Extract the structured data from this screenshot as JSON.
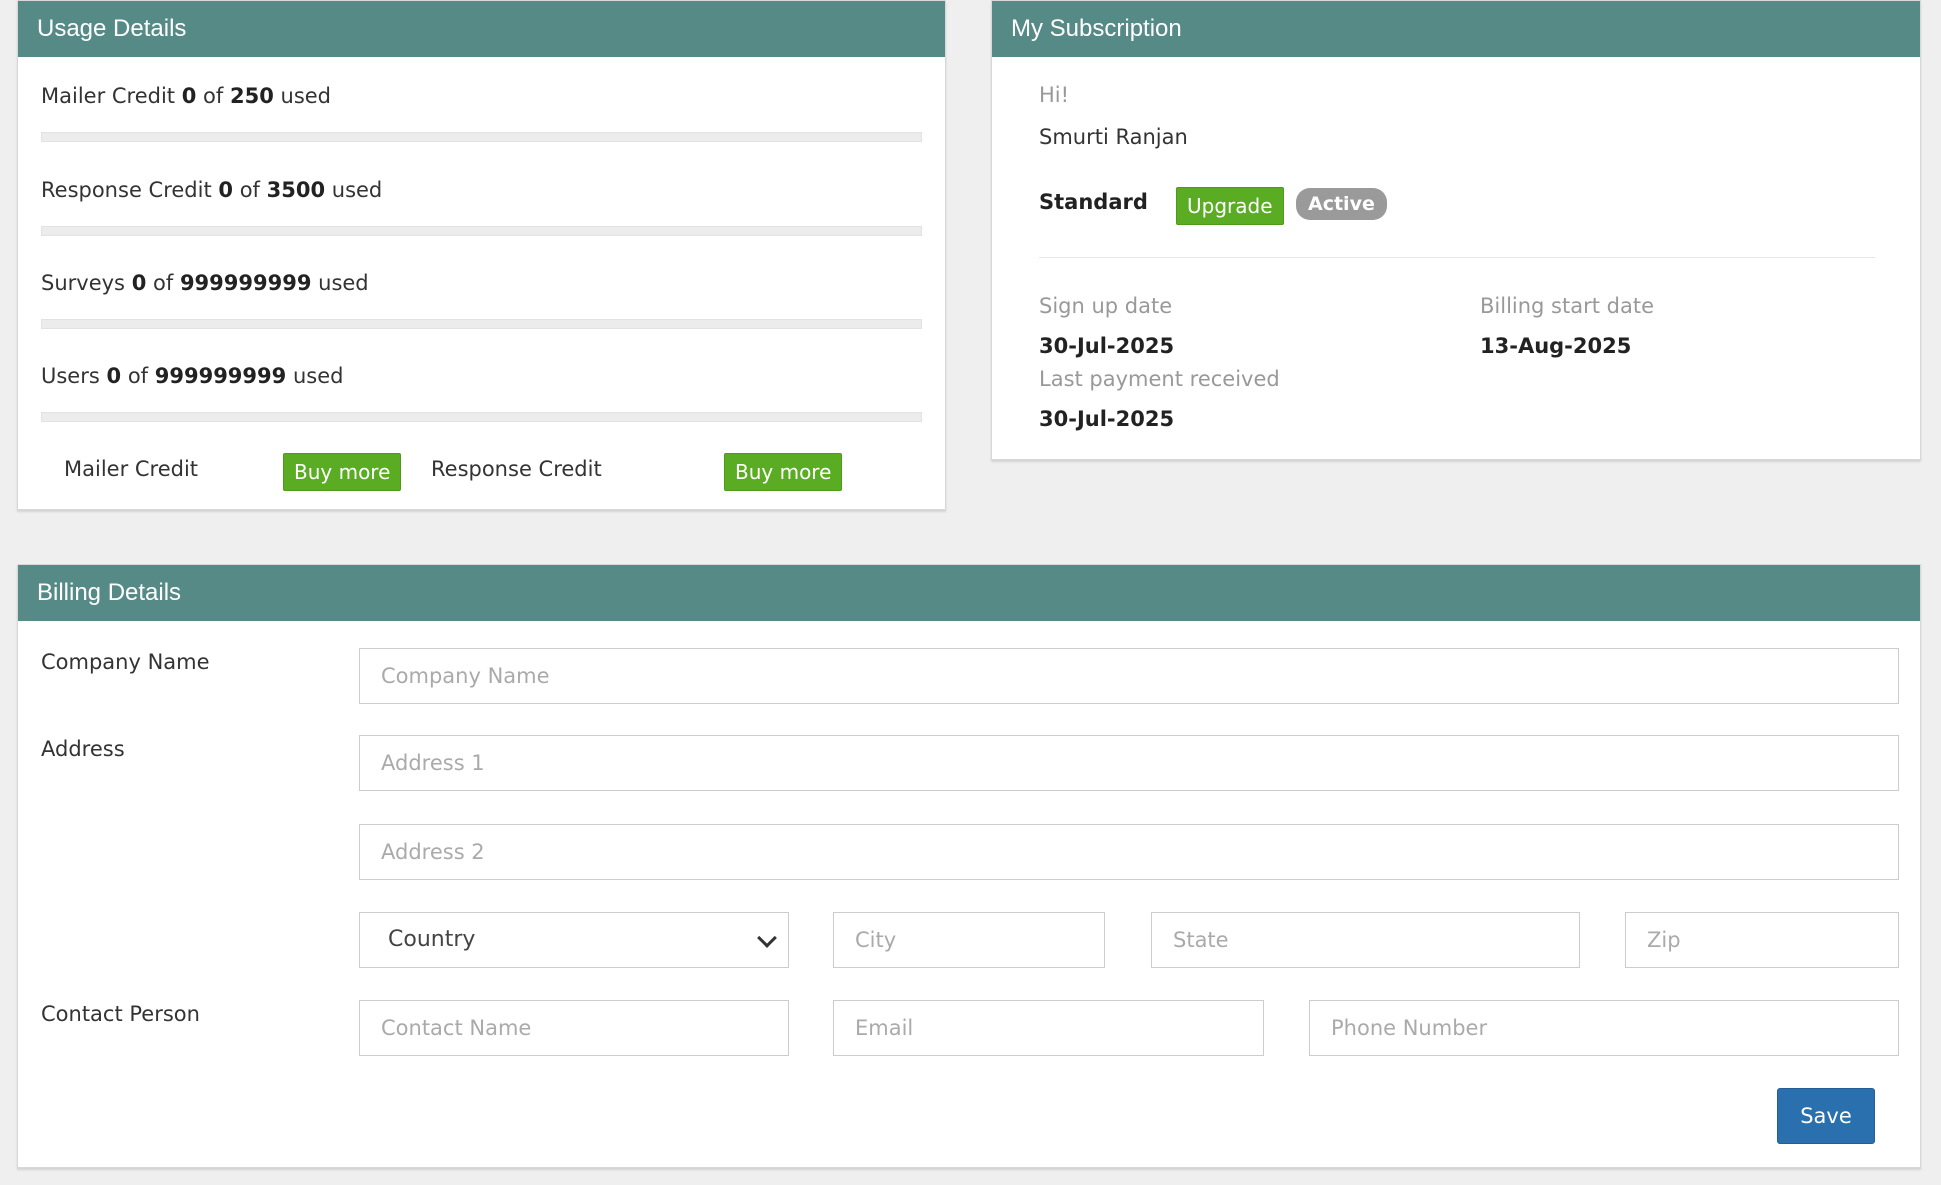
{
  "usage": {
    "title": "Usage Details",
    "items": [
      {
        "label": "Mailer Credit",
        "used": "0",
        "of": "of",
        "total": "250",
        "suffix": "used",
        "fraction": 0
      },
      {
        "label": "Response Credit",
        "used": "0",
        "of": "of",
        "total": "3500",
        "suffix": "used",
        "fraction": 0
      },
      {
        "label": "Surveys",
        "used": "0",
        "of": "of",
        "total": "999999999",
        "suffix": "used",
        "fraction": 0
      },
      {
        "label": "Users",
        "used": "0",
        "of": "of",
        "total": "999999999",
        "suffix": "used",
        "fraction": 0
      }
    ],
    "buy": {
      "mailer_label": "Mailer Credit",
      "response_label": "Response Credit",
      "buy_more": "Buy more"
    }
  },
  "subscription": {
    "title": "My Subscription",
    "greeting": "Hi!",
    "user_name": "Smurti Ranjan",
    "plan": "Standard",
    "upgrade_label": "Upgrade",
    "status": "Active",
    "signup_label": "Sign up date",
    "signup_value": "30-Jul-2025",
    "billing_start_label": "Billing start date",
    "billing_start_value": "13-Aug-2025",
    "last_payment_label": "Last payment received",
    "last_payment_value": "30-Jul-2025"
  },
  "billing": {
    "title": "Billing Details",
    "company_label": "Company Name",
    "company_placeholder": "Company Name",
    "address_label": "Address",
    "address1_placeholder": "Address 1",
    "address2_placeholder": "Address 2",
    "country_selected": "Country",
    "city_placeholder": "City",
    "state_placeholder": "State",
    "zip_placeholder": "Zip",
    "contact_label": "Contact Person",
    "contact_name_placeholder": "Contact Name",
    "email_placeholder": "Email",
    "phone_placeholder": "Phone Number",
    "save_label": "Save"
  },
  "colors": {
    "header": "#568a87",
    "green_button": "#5aad22",
    "save_button": "#2a6fae",
    "badge": "#9a9a9a"
  },
  "icons": {
    "country_dropdown": "chevron-down-icon"
  }
}
